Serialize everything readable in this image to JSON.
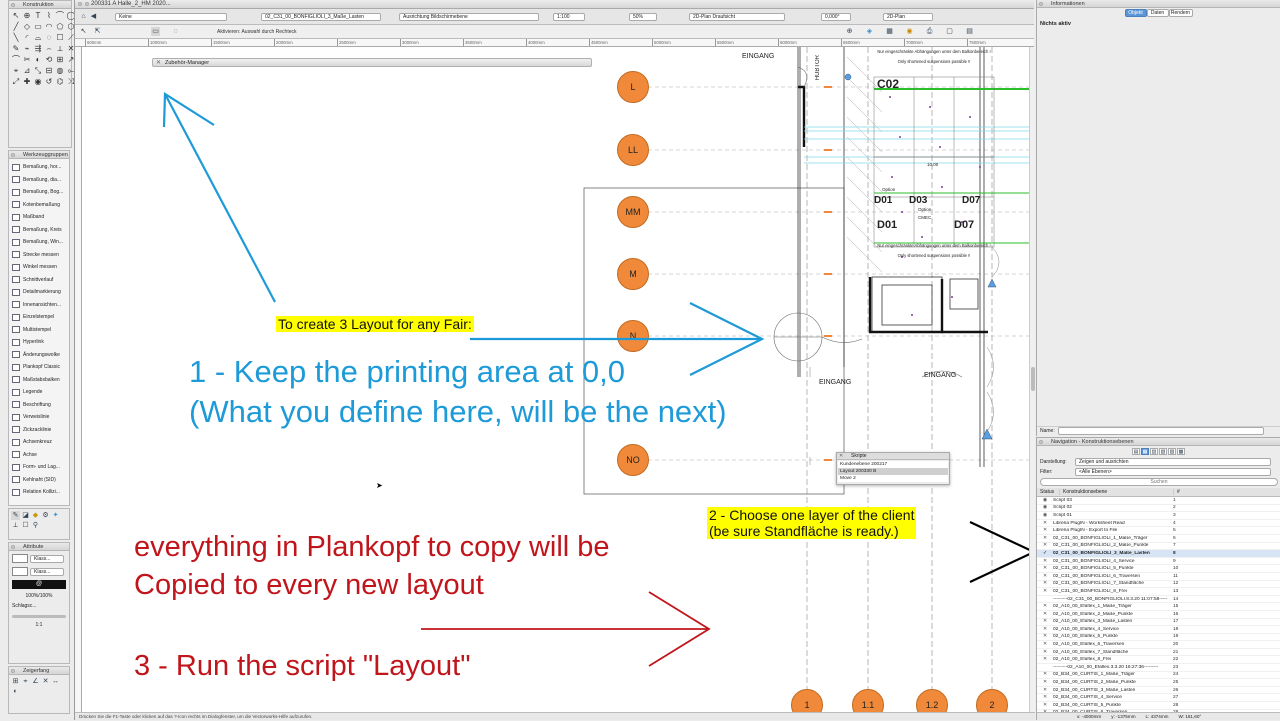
{
  "window": {
    "title": "200331 A Halle_2_HM 2020..."
  },
  "toolbar": {
    "dropdowns": [
      "Keine",
      "02_C31_00_BONFIGLIOLI_3_Maße_Lasten",
      "Ausrichtung Bildschirmebene",
      "1:100",
      "50%",
      "2D-Plan Draufsicht",
      "0,000°",
      "2D-Plan"
    ],
    "mode_hint": "Aktivieren: Auswahl durch Rechteck"
  },
  "left_palettes": {
    "konstruktion_title": "Konstruktion",
    "werkzeuggruppen_title": "Werkzeuggruppen",
    "tools": [
      "Bemaßung, hor...",
      "Bemaßung, dia...",
      "Bemaßung, Bog...",
      "Kotenbemaßung",
      "Maßband",
      "Bemaßung, Kreis",
      "Bemaßung, Win...",
      "Strecke messen",
      "Winkel messen",
      "Schnittverlauf",
      "Detailmarkierung",
      "Innenansichten...",
      "Einzelstempel",
      "Multistempel",
      "Hyperlink",
      "Änderungswolke",
      "Plankopf Classic",
      "Maßstabsbalken",
      "Legende",
      "Beschriftung",
      "Verweislinie",
      "Zickzacklinie",
      "Achsenkreuz",
      "Achse",
      "Form- und Lag...",
      "Kehlnaht (SID)",
      "Relation Kollizi..."
    ],
    "attribute_title": "Attribute",
    "attr_class1": "Klass...",
    "attr_class2": "Klass...",
    "attr_opacity": "100%/100%",
    "attr_shadow": "Schlagsc...",
    "attr_scale": "1:1",
    "zeigerfang_title": "Zeigerfang"
  },
  "ruler": {
    "labels": [
      "600mm",
      "1000mm",
      "1500mm",
      "2000mm",
      "2500mm",
      "3000mm",
      "3500mm",
      "4000mm",
      "4500mm",
      "5000mm",
      "5500mm",
      "6000mm",
      "6500mm",
      "7000mm",
      "7500mm"
    ]
  },
  "zubehoer_manager": {
    "title": "Zubehör-Manager"
  },
  "drawing": {
    "axis_circles": [
      "L",
      "LL",
      "MM",
      "M",
      "N",
      "NO"
    ],
    "bottom_circles": [
      "1",
      "1.1",
      "1.2",
      "2"
    ],
    "room_labels": [
      "C02",
      "D01",
      "D03",
      "D07",
      "D01",
      "D07"
    ],
    "eingang_labels": [
      "EINGANG",
      "EINGANG",
      "EINGANG"
    ],
    "hubtor": "HUBTOR",
    "notes": [
      "Nur eingeschränkte Abhängungen unter dem Balkonbereich !",
      "Only shortened suspensions possible !!",
      "Nur eingeschränkte Abhängungen unter dem Balkonbereich !",
      "Only shortened suspensions possible !!"
    ],
    "option_labels": [
      "Option",
      "CMEC",
      "Option"
    ],
    "dim_value": "10,00"
  },
  "skripte": {
    "title": "Skripte",
    "items": [
      "Kundenebene 200217",
      "Layout 200330 B",
      "Move 2"
    ]
  },
  "annotations": {
    "yellow1": "To create 3 Layout for any Fair:",
    "blue1": "1 - Keep the printing area at 0,0",
    "blue2": "(What you define here, will be the next)",
    "yellow2a": "2 - Choose one layer of the client",
    "yellow2b": "(be sure Standfläche is ready.)",
    "red1": "everything in Plankopf to copy will be",
    "red2": "Copied to every new layout",
    "red3": "3 - Run the script \"Layout\""
  },
  "info_palette": {
    "title": "Informationen",
    "tabs": [
      "Objekt",
      "Daten",
      "Rendern"
    ],
    "status": "Nichts aktiv",
    "name_label": "Name:"
  },
  "navigation": {
    "title": "Navigation - Konstruktionsebenen",
    "darstellung_label": "Darstellung:",
    "darstellung_value": "Zeigen und ausrichten",
    "filter_label": "Filter:",
    "filter_value": "<Alle Ebenen>",
    "search_placeholder": "Suchen",
    "col_status": "Status",
    "col_name": "Konstruktionsebene",
    "col_num": "#",
    "layers": [
      {
        "status": "◉",
        "name": "Script 03",
        "num": "1"
      },
      {
        "status": "◉",
        "name": "Script 02",
        "num": "2"
      },
      {
        "status": "◉",
        "name": "Script 01",
        "num": "3"
      },
      {
        "status": "✕",
        "name": "Libreria PlugIN - Worksheet Read",
        "num": "4"
      },
      {
        "status": "✕",
        "name": "Libreria PlugIN - Export to File",
        "num": "5"
      },
      {
        "status": "✕",
        "name": "02_C31_00_BONFIGLIOLI_1_Maße_Träger",
        "num": "6"
      },
      {
        "status": "✕",
        "name": "02_C31_00_BONFIGLIOLI_2_Maße_Punkte",
        "num": "7"
      },
      {
        "status": "✓",
        "name": "02_C31_00_BONFIGLIOLI_3_Maße_Lasten",
        "num": "8"
      },
      {
        "status": "✕",
        "name": "02_C31_00_BONFIGLIOLI_4_Service",
        "num": "9"
      },
      {
        "status": "✕",
        "name": "02_C31_00_BONFIGLIOLI_5_Punkte",
        "num": "10"
      },
      {
        "status": "✕",
        "name": "02_C31_00_BONFIGLIOLI_6_Traversen",
        "num": "11"
      },
      {
        "status": "✕",
        "name": "02_C31_00_BONFIGLIOLI_7_Standfläche",
        "num": "12"
      },
      {
        "status": "✕",
        "name": "02_C31_00_BONFIGLIOLI_8_Frei",
        "num": "13"
      },
      {
        "status": "",
        "name": "---------02_C31_00_BONFIGLIOLI.8.3.20  11:07:58-----",
        "num": "14"
      },
      {
        "status": "✕",
        "name": "02_A10_00_Efaflex_1_Maße_Träger",
        "num": "15"
      },
      {
        "status": "✕",
        "name": "02_A10_00_Efaflex_2_Maße_Punkte",
        "num": "16"
      },
      {
        "status": "✕",
        "name": "02_A10_00_Efaflex_3_Maße_Lasten",
        "num": "17"
      },
      {
        "status": "✕",
        "name": "02_A10_00_Efaflex_4_Service",
        "num": "18"
      },
      {
        "status": "✕",
        "name": "02_A10_00_Efaflex_5_Punkte",
        "num": "19"
      },
      {
        "status": "✕",
        "name": "02_A10_00_Efaflex_6_Traversen",
        "num": "20"
      },
      {
        "status": "✕",
        "name": "02_A10_00_Efaflex_7_Standfläche",
        "num": "21"
      },
      {
        "status": "✕",
        "name": "02_A10_00_Efaflex_8_Frei",
        "num": "22"
      },
      {
        "status": "",
        "name": "---------02_A10_00_Efaflex.3.3.20  16:27:36---------",
        "num": "23"
      },
      {
        "status": "✕",
        "name": "02_B34_00_CURTIS_1_Maße_Träger",
        "num": "24"
      },
      {
        "status": "✕",
        "name": "02_B34_00_CURTIS_2_Maße_Punkte",
        "num": "25"
      },
      {
        "status": "✕",
        "name": "02_B34_00_CURTIS_3_Maße_Lasten",
        "num": "26"
      },
      {
        "status": "✕",
        "name": "02_B34_00_CURTIS_4_Service",
        "num": "27"
      },
      {
        "status": "✕",
        "name": "02_B34_00_CURTIS_5_Punkte",
        "num": "28"
      },
      {
        "status": "✕",
        "name": "02_B34_00_CURTIS_6_Traversen",
        "num": "29"
      }
    ]
  },
  "status_bar": {
    "hint": "Drücken Sie die F1-Taste oder klicken auf das ?-Icon rechts im Dialogfenster, um die Vectorworks-Hilfe aufzurufen.",
    "x": "x: -4000mm",
    "y": "y: -1375mm",
    "l": "L: 4374mm",
    "w": "W: 161,60°"
  },
  "colors": {
    "blue_text": "#1d9ad8",
    "red_text": "#c0151b",
    "yellow_hl": "#ffff00",
    "orange_circle": "#f08a3a"
  }
}
